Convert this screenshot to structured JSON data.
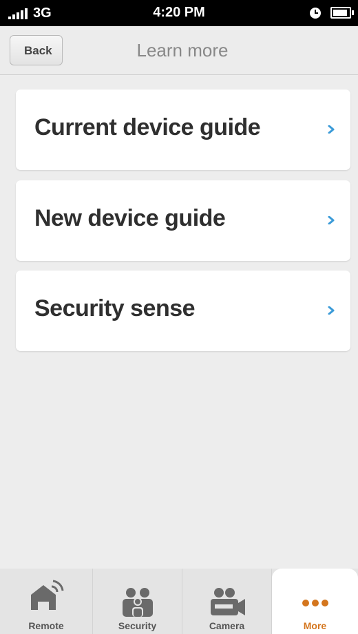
{
  "status_bar": {
    "carrier": "3G",
    "time": "4:20 PM",
    "icons": [
      "signal-icon",
      "clock-icon",
      "battery-icon"
    ]
  },
  "nav": {
    "back_label": "Back",
    "title": "Learn more"
  },
  "list": {
    "items": [
      {
        "label": "Current device guide",
        "icon": "chevron-right-icon"
      },
      {
        "label": "New device guide",
        "icon": "chevron-right-icon"
      },
      {
        "label": "Security sense",
        "icon": "chevron-right-icon"
      }
    ]
  },
  "tabs": [
    {
      "label": "Remote",
      "icon": "house-wifi-icon",
      "active": false
    },
    {
      "label": "Security",
      "icon": "people-icon",
      "active": false
    },
    {
      "label": "Camera",
      "icon": "video-camera-icon",
      "active": false
    },
    {
      "label": "More",
      "icon": "more-dots-icon",
      "active": true
    }
  ],
  "colors": {
    "accent": "#d4761e",
    "chevron": "#3b9bd8",
    "background": "#ededed"
  }
}
